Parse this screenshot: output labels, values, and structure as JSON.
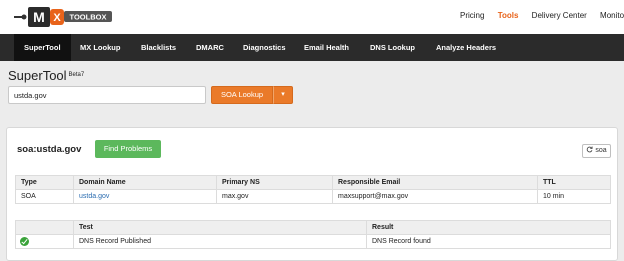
{
  "logo": {
    "text": "MX TOOLBOX"
  },
  "top_nav": [
    "Pricing",
    "Tools",
    "Delivery Center",
    "Monito"
  ],
  "main_nav": [
    "SuperTool",
    "MX Lookup",
    "Blacklists",
    "DMARC",
    "Diagnostics",
    "Email Health",
    "DNS Lookup",
    "Analyze Headers"
  ],
  "supertool": {
    "title": "SuperTool",
    "badge": "Beta7"
  },
  "search": {
    "value": "ustda.gov",
    "button": "SOA Lookup",
    "caret": "▾"
  },
  "result": {
    "title": "soa:ustda.gov",
    "find_problems": "Find Problems",
    "refresh_label": "soa",
    "columns": [
      "Type",
      "Domain Name",
      "Primary NS",
      "Responsible Email",
      "TTL"
    ],
    "rows": [
      [
        "SOA",
        "ustda.gov",
        "max.gov",
        "maxsupport@max.gov",
        "10 min"
      ]
    ],
    "test_columns": [
      "",
      "Test",
      "Result"
    ],
    "tests": [
      {
        "status": "pass",
        "test": "DNS Record Published",
        "result": "DNS Record found"
      }
    ]
  },
  "colors": {
    "accent": "#e8631a",
    "button_orange": "#ea7a29",
    "button_green": "#5cb85c",
    "nav_dark": "#2b2b2b"
  }
}
